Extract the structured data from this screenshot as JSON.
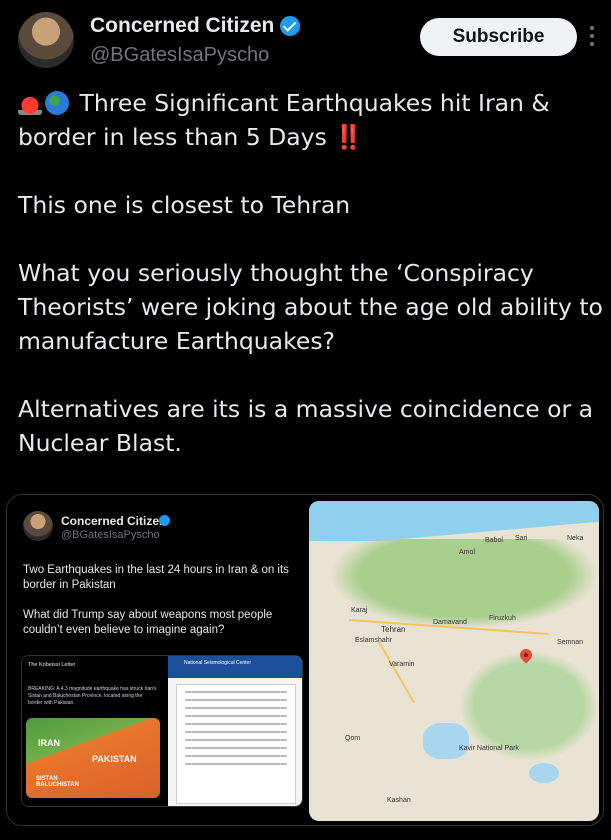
{
  "tweet": {
    "author_name": "Concerned Citizen",
    "author_handle": "@BGatesIsaPyscho",
    "subscribe_label": "Subscribe",
    "line1": "Three Significant Earthquakes hit Iran & border in less than 5 Days",
    "line1_mark": "‼️",
    "line2": "This one is closest to Tehran",
    "line3": "What you seriously thought the ‘Conspiracy Theorists’ were joking about the age old ability to manufacture Earthquakes?",
    "line4": "Alternatives are its is a massive coincidence or a Nuclear Blast."
  },
  "quoted": {
    "author_name": "Concerned Citizen",
    "author_handle": "@BGatesIsaPyscho",
    "text1": "Two Earthquakes in the last 24 hours in Iran & on its border in Pakistan",
    "text2": "What did Trump say about weapons most people couldn’t even believe to imagine again?",
    "sub_title": "The Kobeissi Letter",
    "sub_body": "BREAKING: A 4.3 magnitude earthquake has struck Iran's Sistan and Baluchestan Province, located along the border with Pakistan.",
    "map_labels": [
      "IRAN",
      "PAKISTAN",
      "SISTAN BALUCHISTAN"
    ],
    "doc_header": "National Seismological Center"
  },
  "map": {
    "labels": [
      "Babol",
      "Amol",
      "Karaj",
      "Tehran",
      "Eslamshahr",
      "Damavand",
      "Firuzkuh",
      "Semnan",
      "Varamin",
      "Qom",
      "Kashan",
      "Kavir National Park",
      "Sari",
      "Neka"
    ]
  },
  "colors": {
    "accent": "#1d9bf0",
    "background": "#000000",
    "pin": "#e74a3b"
  }
}
